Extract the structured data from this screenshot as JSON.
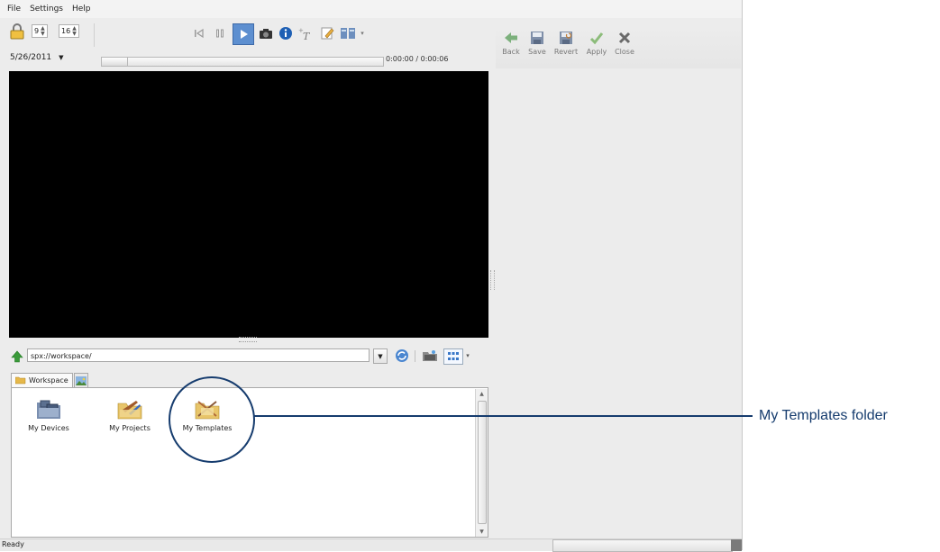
{
  "menu": [
    "File",
    "Settings",
    "Help"
  ],
  "player": {
    "spin1": "9",
    "spin2": "16",
    "date": "5/26/2011",
    "timecode": "0:00:00 / 0:00:06"
  },
  "editor_toolbar": {
    "back": "Back",
    "save": "Save",
    "revert": "Revert",
    "apply": "Apply",
    "close": "Close"
  },
  "browser": {
    "path": "spx://workspace/",
    "tabs": [
      "Workspace"
    ],
    "items": [
      {
        "label": "My Devices",
        "icon": "devices-folder-icon"
      },
      {
        "label": "My Projects",
        "icon": "projects-folder-icon"
      },
      {
        "label": "My Templates",
        "icon": "templates-folder-icon"
      }
    ]
  },
  "status": "Ready",
  "annotation": {
    "label": "My Templates folder",
    "color": "#163c6e"
  },
  "colors": {
    "accent_green": "#3a9a3a",
    "info_blue": "#1e5fb4"
  }
}
